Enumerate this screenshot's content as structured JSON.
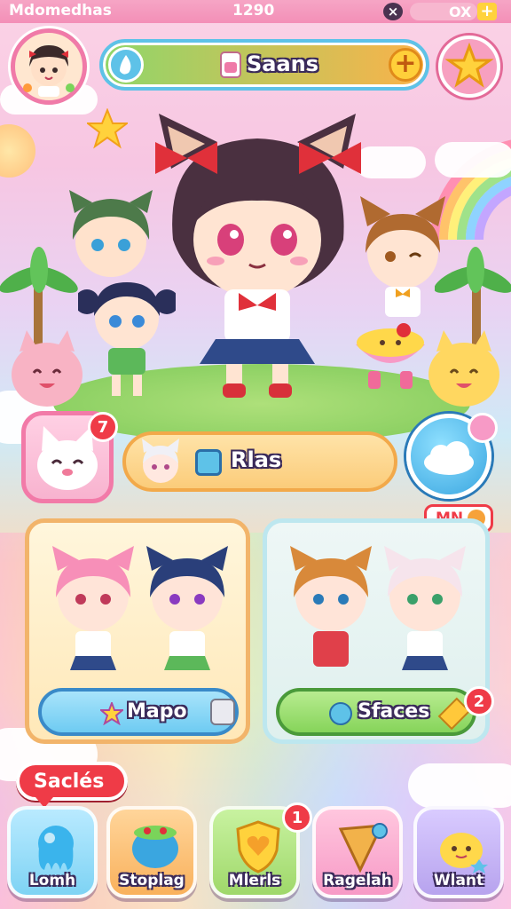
{
  "status_bar": {
    "title": "Mdomedhas",
    "value": "1290",
    "close_glyph": "×",
    "counter": "OX",
    "add_glyph": "+"
  },
  "top_bar": {
    "currency_label": "Saans",
    "add_glyph": "+",
    "star_icon": "star-icon"
  },
  "event_row": {
    "badge_count": "7",
    "label": "Rlas"
  },
  "cards": {
    "tag": "MN",
    "left": {
      "label": "Mapo"
    },
    "right": {
      "label": "Sfaces",
      "badge_count": "2"
    }
  },
  "speech_tag": "Saclés",
  "nav": [
    {
      "label": "Lomh",
      "icon": "jelly-icon",
      "color": "#7ed3f4"
    },
    {
      "label": "Stoplag",
      "icon": "bowl-icon",
      "color": "#f9b15c"
    },
    {
      "label": "Mlerls",
      "icon": "heart-shield-icon",
      "color": "#9fd86a",
      "badge": "1"
    },
    {
      "label": "Ragelah",
      "icon": "cheese-icon",
      "color": "#f79ac6"
    },
    {
      "label": "Wlant",
      "icon": "slime-icon",
      "color": "#b7a3ee"
    }
  ],
  "colors": {
    "accent_pink": "#f38fb7",
    "currency_bar_start": "#8fd66a",
    "currency_bar_end": "#fbb24a",
    "star": "#ffd23c",
    "badge_red": "#ef3b47"
  }
}
